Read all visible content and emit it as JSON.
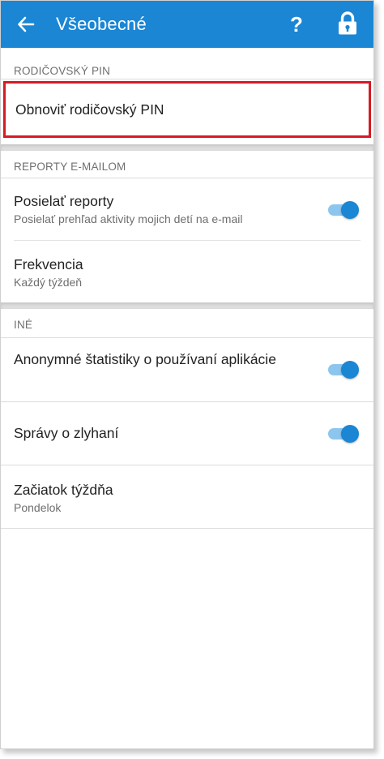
{
  "appbar": {
    "title": "Všeobecné",
    "back_icon": "arrow-left-icon",
    "help_label": "?",
    "lock_icon": "lock-icon",
    "color": "#1a86d4"
  },
  "sections": {
    "pin": {
      "header": "RODIČOVSKÝ PIN",
      "reset_pin_label": "Obnoviť rodičovský PIN",
      "highlight_color": "#d61b23"
    },
    "email_reports": {
      "header": "REPORTY E-MAILOM",
      "send_reports": {
        "title": "Posielať reporty",
        "subtitle": "Posielať prehľad aktivity mojich detí na e-mail",
        "enabled": true
      },
      "frequency": {
        "title": "Frekvencia",
        "value": "Každý týždeň"
      }
    },
    "other": {
      "header": "INÉ",
      "anonymous_stats": {
        "title": "Anonymné štatistiky o používaní aplikácie",
        "enabled": true
      },
      "crash_reports": {
        "title": "Správy o zlyhaní",
        "enabled": true
      },
      "week_start": {
        "title": "Začiatok týždňa",
        "value": "Pondelok"
      }
    }
  }
}
